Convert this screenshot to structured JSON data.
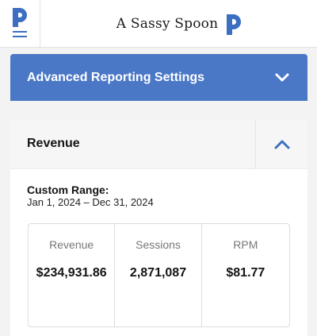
{
  "header": {
    "site_name": "A Sassy Spoon",
    "menu_icon": "hamburger-icon",
    "logo_icon": "p-logo-icon"
  },
  "advanced_settings": {
    "title": "Advanced Reporting Settings",
    "icon": "chevron-down-icon",
    "expanded": false
  },
  "revenue_card": {
    "title": "Revenue",
    "icon": "chevron-up-icon",
    "expanded": true,
    "range_label": "Custom Range:",
    "range_value": "Jan 1, 2024 – Dec 31, 2024",
    "stats": [
      {
        "label": "Revenue",
        "value": "$234,931.86"
      },
      {
        "label": "Sessions",
        "value": "2,871,087"
      },
      {
        "label": "RPM",
        "value": "$81.77"
      }
    ]
  },
  "colors": {
    "accent": "#4a78c7",
    "logo": "#3c6fc2"
  }
}
